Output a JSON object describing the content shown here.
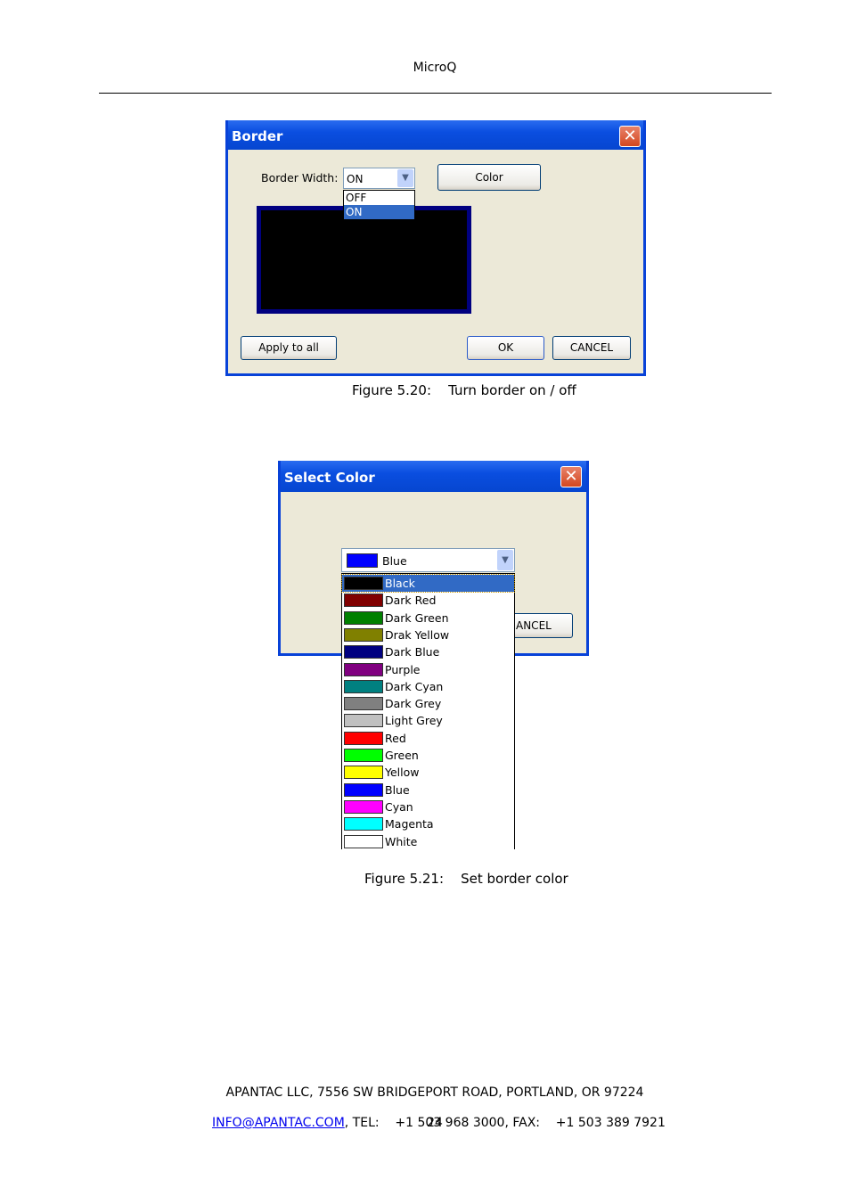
{
  "header": {
    "title": "MicroQ"
  },
  "figure1": {
    "caption": "Figure 5.20:    Turn border on / off",
    "dialog": {
      "title": "Border",
      "border_width_label": "Border Width:",
      "border_width_value": "ON",
      "border_width_options": [
        "OFF",
        "ON"
      ],
      "color_button": "Color",
      "apply_button": "Apply to all",
      "ok_button": "OK",
      "cancel_button": "CANCEL",
      "preview_border_color": "#000080",
      "preview_fill_color": "#000000"
    }
  },
  "figure2": {
    "caption": "Figure 5.21:    Set border color",
    "dialog": {
      "title": "Select Color",
      "selected_color": {
        "label": "Blue",
        "color": "#0000ff"
      },
      "cancel_button_partial": "ANCEL",
      "options": [
        {
          "label": "Black",
          "color": "#000000"
        },
        {
          "label": "Dark Red",
          "color": "#800000"
        },
        {
          "label": "Dark Green",
          "color": "#008000"
        },
        {
          "label": "Drak Yellow",
          "color": "#808000"
        },
        {
          "label": "Dark Blue",
          "color": "#000080"
        },
        {
          "label": "Purple",
          "color": "#800080"
        },
        {
          "label": "Dark Cyan",
          "color": "#008080"
        },
        {
          "label": "Dark Grey",
          "color": "#808080"
        },
        {
          "label": "Light Grey",
          "color": "#c0c0c0"
        },
        {
          "label": "Red",
          "color": "#ff0000"
        },
        {
          "label": "Green",
          "color": "#00ff00"
        },
        {
          "label": "Yellow",
          "color": "#ffff00"
        },
        {
          "label": "Blue",
          "color": "#0000ff"
        },
        {
          "label": "Cyan",
          "color": "#ff00ff"
        },
        {
          "label": "Magenta",
          "color": "#00ffff"
        },
        {
          "label": "White",
          "color": "#ffffff"
        }
      ],
      "highlighted_index": 0
    }
  },
  "footer": {
    "address": "APANTAC LLC, 7556 SW BRIDGEPORT ROAD, PORTLAND, OR 97224",
    "email": "INFO@APANTAC.COM",
    "contact": ", TEL:    +1 503 968 3000, FAX:    +1 503 389 7921",
    "page_number": "24"
  }
}
